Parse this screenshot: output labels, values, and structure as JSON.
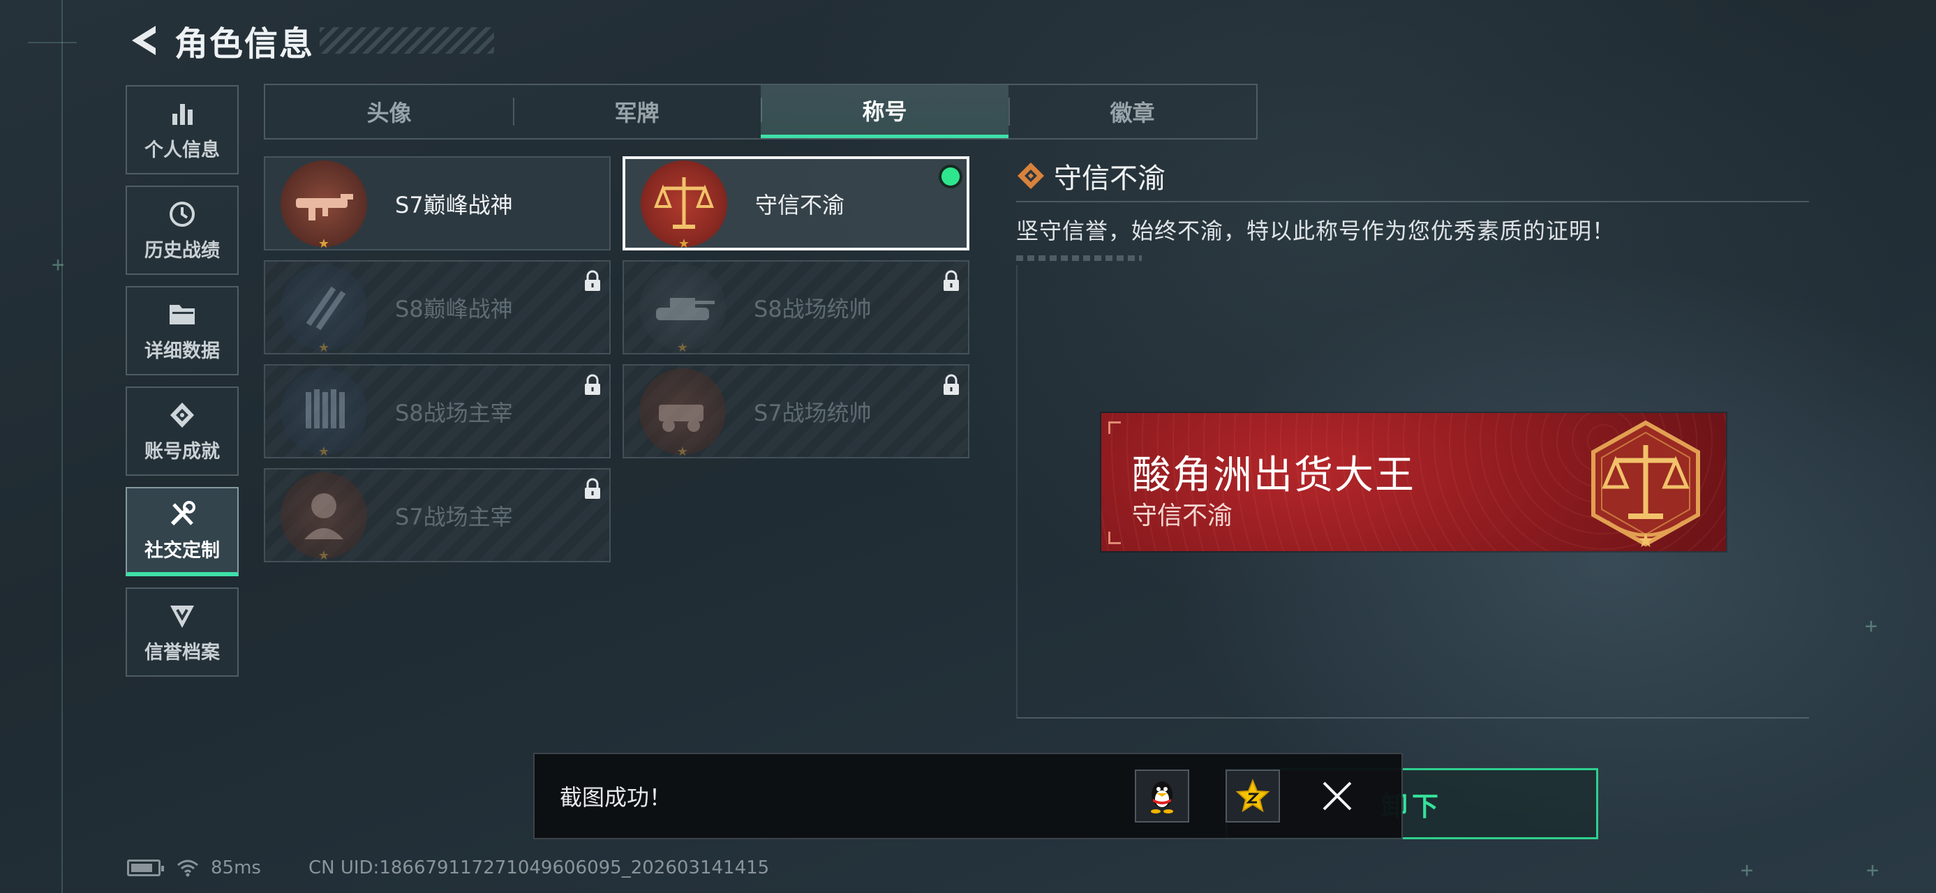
{
  "header": {
    "title": "角色信息"
  },
  "sidenav": {
    "items": [
      {
        "label": "个人信息",
        "icon": "bar-chart-icon",
        "active": false
      },
      {
        "label": "历史战绩",
        "icon": "history-clock-icon",
        "active": false
      },
      {
        "label": "详细数据",
        "icon": "folder-icon",
        "active": false
      },
      {
        "label": "账号成就",
        "icon": "achievement-icon",
        "active": false
      },
      {
        "label": "社交定制",
        "icon": "tools-icon",
        "active": true
      },
      {
        "label": "信誉档案",
        "icon": "credit-shield-icon",
        "active": false
      }
    ]
  },
  "tabs": [
    {
      "label": "头像",
      "active": false
    },
    {
      "label": "军牌",
      "active": false
    },
    {
      "label": "称号",
      "active": true
    },
    {
      "label": "徽章",
      "active": false
    }
  ],
  "titles": [
    {
      "name": "S7巅峰战神",
      "locked": false,
      "selected": false,
      "emblem": "rifle-emblem-icon"
    },
    {
      "name": "守信不渝",
      "locked": false,
      "selected": true,
      "equipped": true,
      "emblem": "scales-emblem-icon"
    },
    {
      "name": "S8巅峰战神",
      "locked": true,
      "selected": false,
      "emblem": "stripes-emblem-icon"
    },
    {
      "name": "S8战场统帅",
      "locked": true,
      "selected": false,
      "emblem": "tank-emblem-icon"
    },
    {
      "name": "S8战场主宰",
      "locked": true,
      "selected": false,
      "emblem": "bullets-emblem-icon"
    },
    {
      "name": "S7战场统帅",
      "locked": true,
      "selected": false,
      "emblem": "vehicle-emblem-icon"
    },
    {
      "name": "S7战场主宰",
      "locked": true,
      "selected": false,
      "emblem": "soldier-emblem-icon"
    }
  ],
  "detail": {
    "title": "守信不渝",
    "description": "坚守信誉，始终不渝，特以此称号作为您优秀素质的证明！"
  },
  "banner": {
    "player_name": "酸角洲出货大王",
    "title": "守信不渝"
  },
  "unequip_button": {
    "label": "卸下"
  },
  "toast": {
    "message": "截图成功！"
  },
  "statusbar": {
    "ping": "85ms",
    "uid": "CN UID:18667911727104960609​5_202603141415"
  },
  "colors": {
    "accent": "#3fe0a8",
    "banner_red": "#9e2024",
    "gold": "#d9a23b"
  }
}
